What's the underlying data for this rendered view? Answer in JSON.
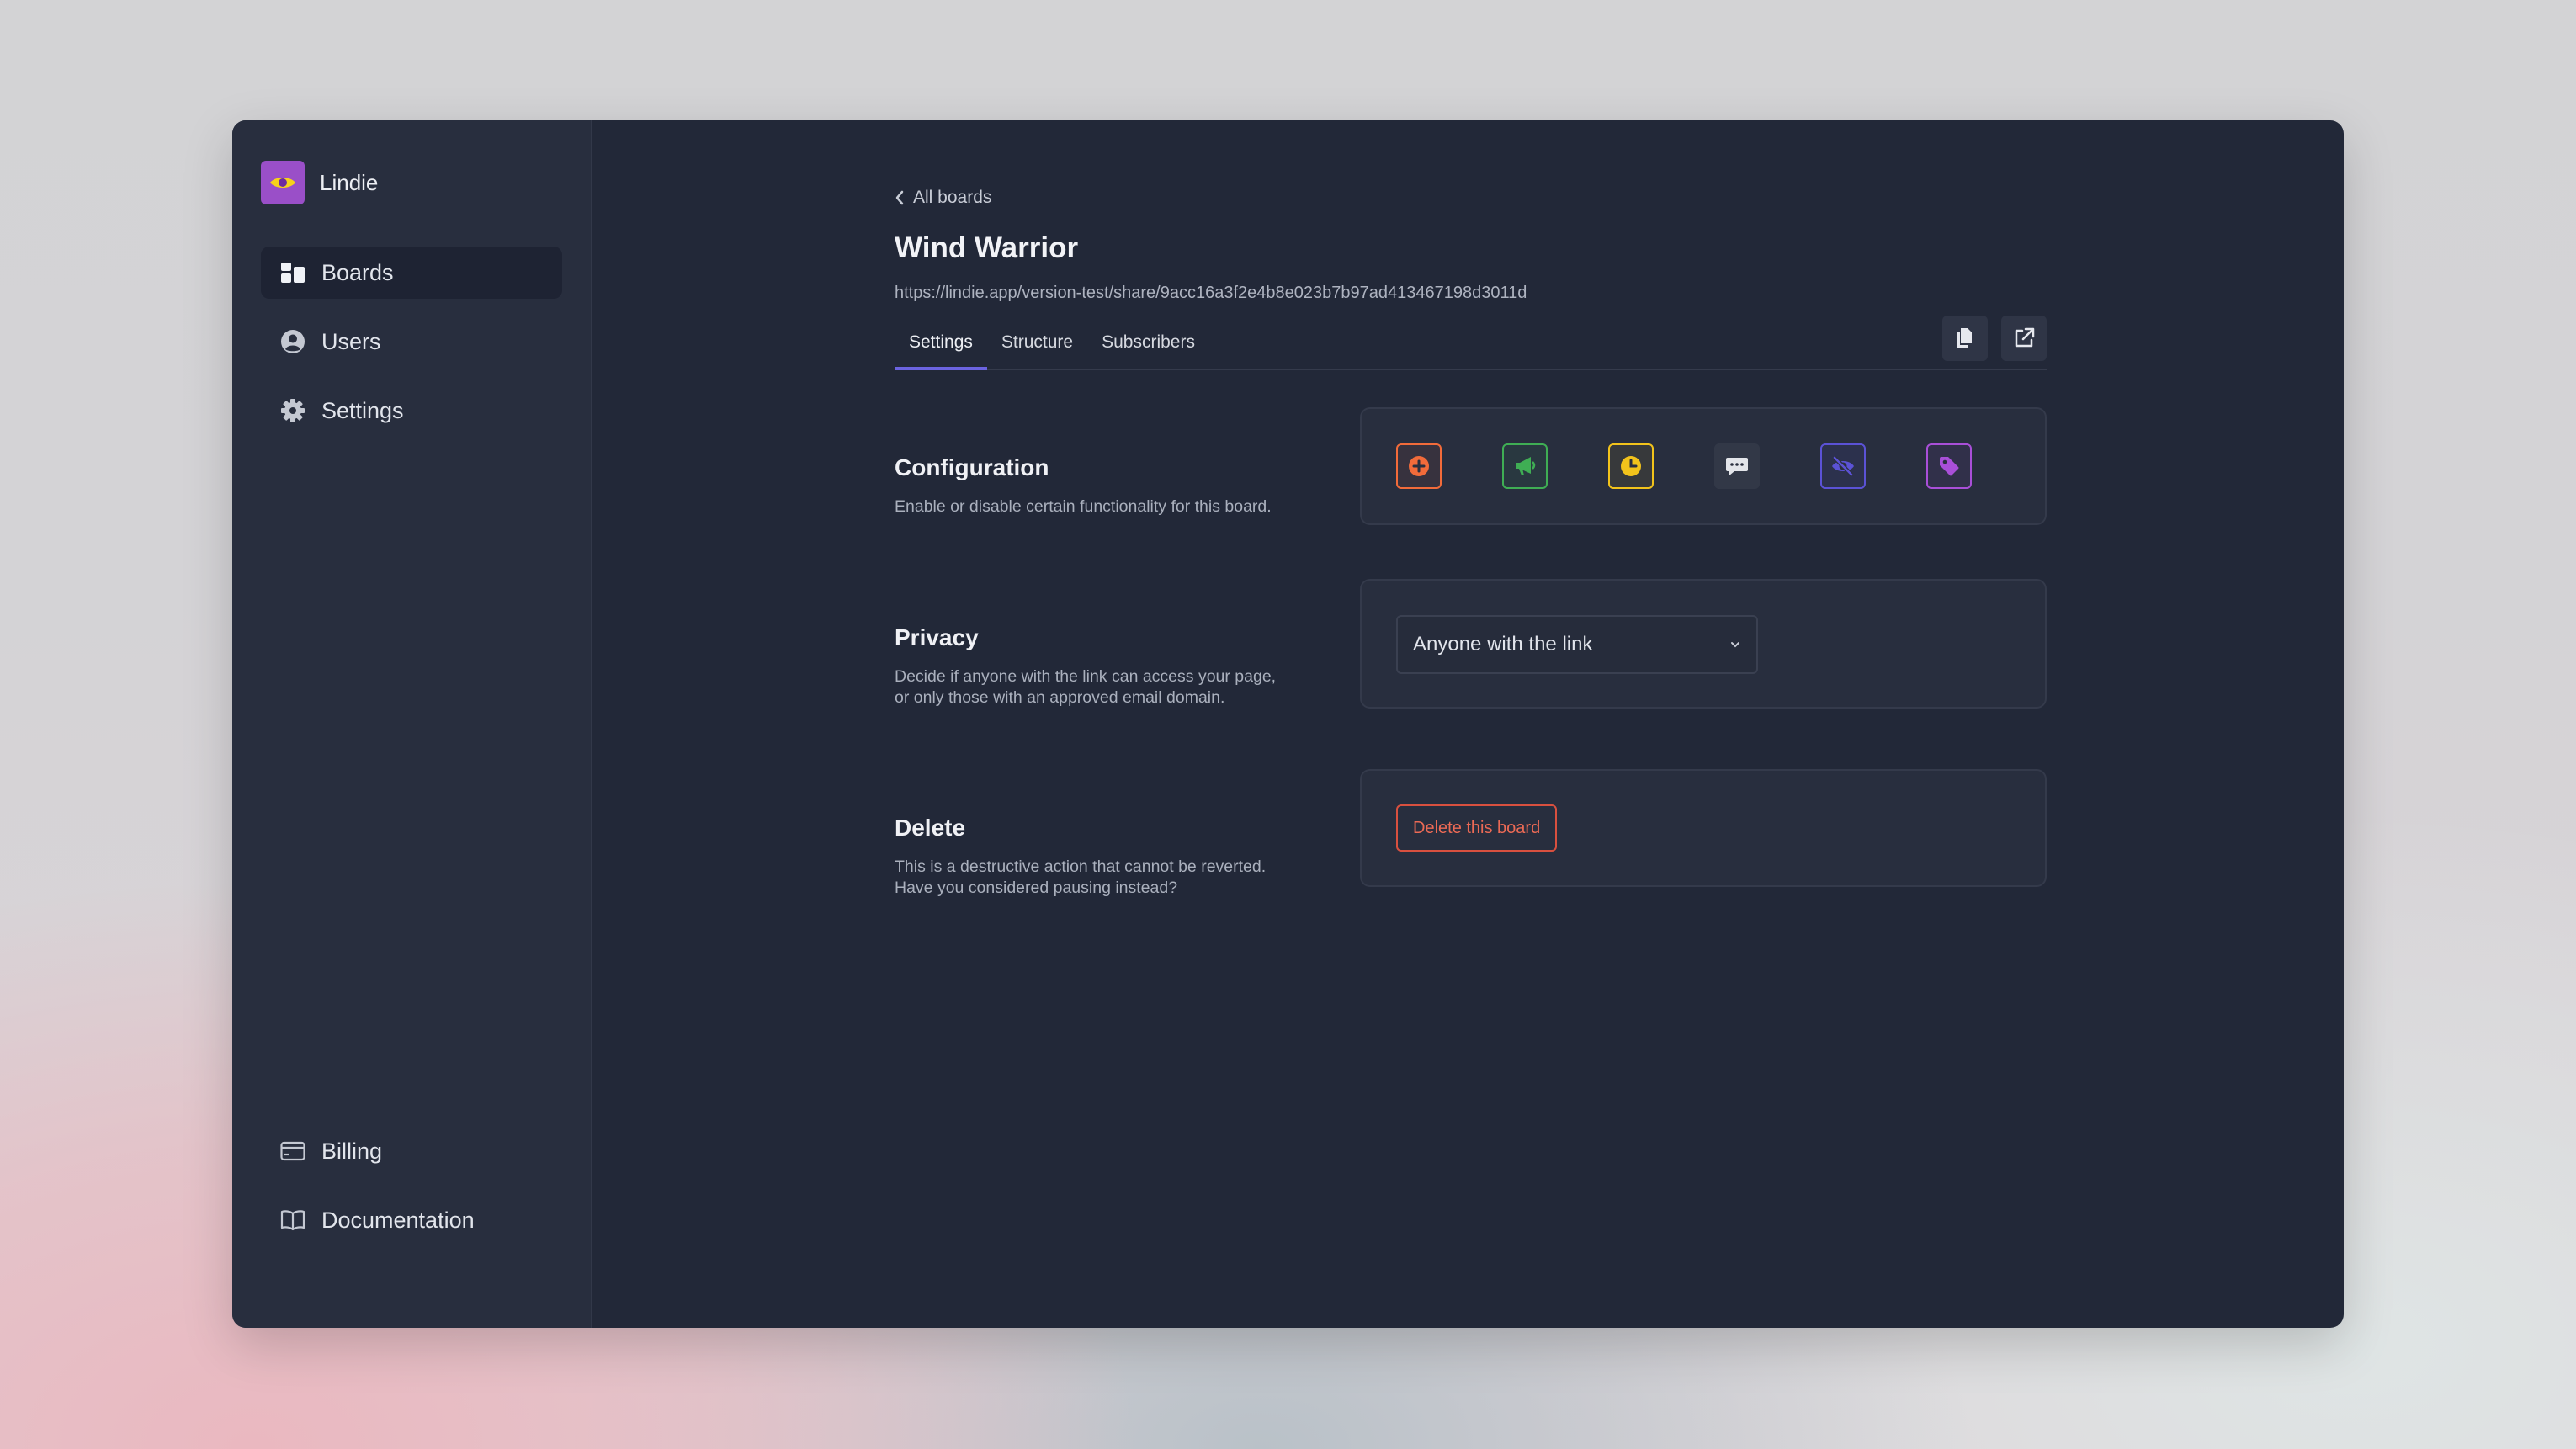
{
  "brand": {
    "name": "Lindie",
    "logo_icon": "eye-icon",
    "logo_color": "#9a4fc8"
  },
  "sidebar": {
    "items": [
      {
        "label": "Boards",
        "icon": "boards-icon",
        "active": true
      },
      {
        "label": "Users",
        "icon": "user-circle-icon"
      },
      {
        "label": "Settings",
        "icon": "gear-icon"
      }
    ],
    "bottom_items": [
      {
        "label": "Billing",
        "icon": "credit-card-icon"
      },
      {
        "label": "Documentation",
        "icon": "book-icon"
      }
    ]
  },
  "header": {
    "back_label": "All boards",
    "title": "Wind Warrior",
    "url": "https://lindie.app/version-test/share/9acc16a3f2e4b8e023b7b97ad413467198d3011d",
    "actions": [
      "copy-icon",
      "external-link-icon"
    ]
  },
  "tabs": [
    {
      "label": "Settings",
      "active": true
    },
    {
      "label": "Structure"
    },
    {
      "label": "Subscribers"
    }
  ],
  "sections": {
    "configuration": {
      "title": "Configuration",
      "description": "Enable or disable certain functionality for this board.",
      "toggles": [
        {
          "icon": "plus-circle-icon",
          "color": "#f26b3a",
          "enabled": true
        },
        {
          "icon": "megaphone-icon",
          "color": "#3fae54",
          "enabled": true
        },
        {
          "icon": "clock-icon",
          "color": "#f2c31b",
          "enabled": true
        },
        {
          "icon": "chat-bubble-icon",
          "color": "#d9dce3",
          "enabled": false
        },
        {
          "icon": "eye-slash-icon",
          "color": "#5b52d6",
          "enabled": true
        },
        {
          "icon": "tag-icon",
          "color": "#a94fd8",
          "enabled": true
        }
      ]
    },
    "privacy": {
      "title": "Privacy",
      "description_line1": "Decide if anyone with the link can access your page,",
      "description_line2": "or only those with an approved email domain.",
      "select_value": "Anyone with the link"
    },
    "delete": {
      "title": "Delete",
      "description_line1": "This is a destructive action that cannot be reverted.",
      "description_line2": "Have you considered pausing instead?",
      "button_label": "Delete this board"
    }
  }
}
